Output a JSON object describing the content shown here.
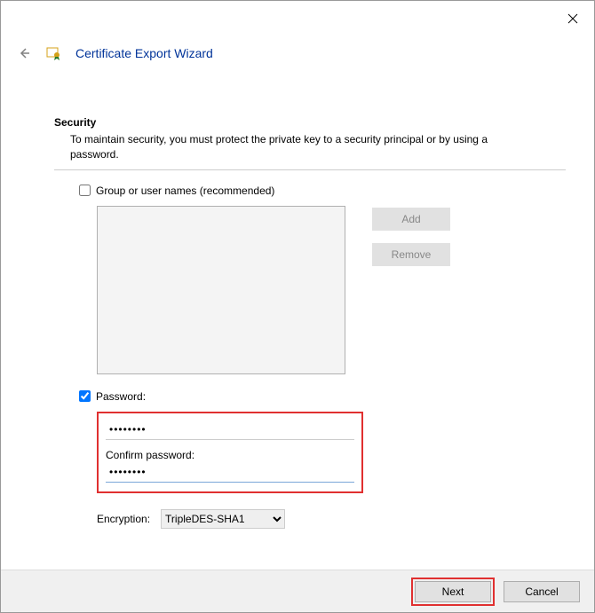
{
  "window": {
    "title": "Certificate Export Wizard"
  },
  "section": {
    "title": "Security",
    "description": "To maintain security, you must protect the private key to a security principal or by using a password."
  },
  "group_names": {
    "checkbox_label": "Group or user names (recommended)",
    "add_label": "Add",
    "remove_label": "Remove"
  },
  "password": {
    "checkbox_label": "Password:",
    "value": "••••••••",
    "confirm_label": "Confirm password:",
    "confirm_value": "••••••••"
  },
  "encryption": {
    "label": "Encryption:",
    "selected": "TripleDES-SHA1"
  },
  "footer": {
    "next": "Next",
    "cancel": "Cancel"
  }
}
